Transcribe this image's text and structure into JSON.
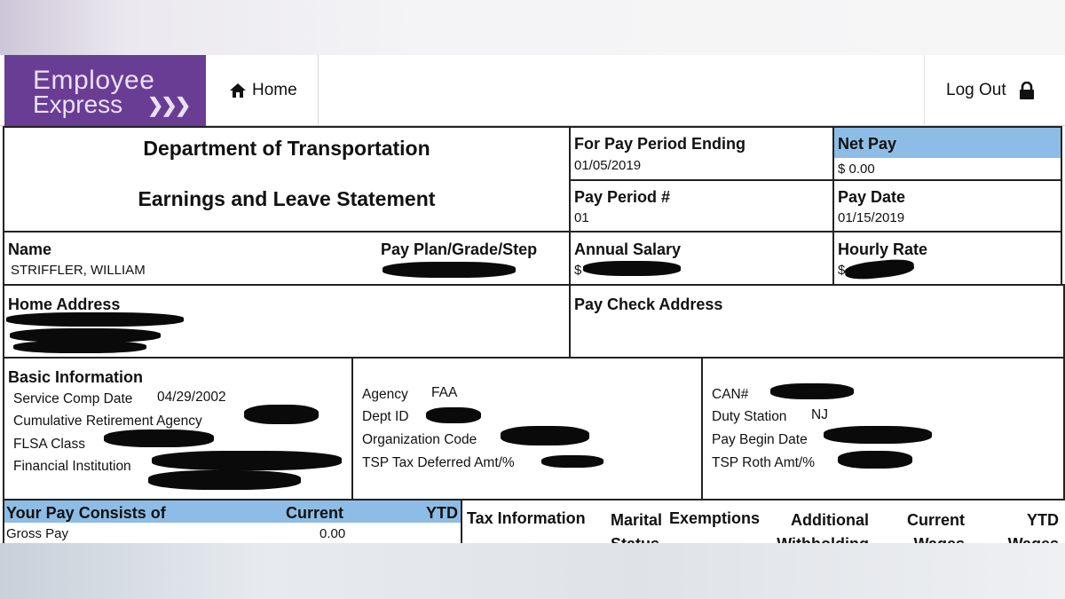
{
  "nav": {
    "logo_line1": "Employee",
    "logo_line2": "Express",
    "home_label": "Home",
    "logout_label": "Log Out"
  },
  "header": {
    "department": "Department of Transportation",
    "statement_title": "Earnings and Leave Statement"
  },
  "pay_period_ending": {
    "label": "For Pay Period Ending",
    "value": "01/05/2019"
  },
  "net_pay": {
    "label": "Net Pay",
    "value": "$ 0.00"
  },
  "pay_period_num": {
    "label": "Pay Period #",
    "value": "01"
  },
  "pay_date": {
    "label": "Pay Date",
    "value": "01/15/2019"
  },
  "name": {
    "label": "Name",
    "value": "STRIFFLER, WILLIAM"
  },
  "pay_plan": {
    "label": "Pay Plan/Grade/Step"
  },
  "annual_salary": {
    "label": "Annual Salary",
    "prefix": "$"
  },
  "hourly_rate": {
    "label": "Hourly Rate",
    "prefix": "$"
  },
  "home_address": {
    "label": "Home Address"
  },
  "pay_check_address": {
    "label": "Pay Check Address"
  },
  "basic_info": {
    "label": "Basic Information",
    "service_comp_date_label": "Service Comp Date",
    "service_comp_date_value": "04/29/2002",
    "cumulative_retirement_label": "Cumulative Retirement Agency",
    "flsa_label": "FLSA Class",
    "financial_institution_label": "Financial Institution"
  },
  "agency_info": {
    "agency_label": "Agency",
    "agency_value": "FAA",
    "dept_id_label": "Dept ID",
    "org_code_label": "Organization Code",
    "tsp_deferred_label": "TSP Tax Deferred Amt/%"
  },
  "can_info": {
    "can_label": "CAN#",
    "duty_station_label": "Duty Station",
    "duty_station_value": "NJ",
    "pay_begin_label": "Pay Begin Date",
    "tsp_roth_label": "TSP Roth Amt/%"
  },
  "pay_consists": {
    "label": "Your Pay Consists of",
    "current_header": "Current",
    "ytd_header": "YTD",
    "rows": [
      {
        "label": "Gross Pay",
        "current": "0.00"
      }
    ]
  },
  "tax_info": {
    "label": "Tax Information",
    "marital_status": "Marital Status",
    "exemptions": "Exemptions",
    "additional_withholding": "Additional Withholding",
    "current_wages": "Current Wages",
    "ytd_wages": "YTD Wages"
  },
  "colors": {
    "logo_purple": "#6a3d95",
    "header_blue": "#8dbde6",
    "redaction": "#0a0a0a"
  }
}
